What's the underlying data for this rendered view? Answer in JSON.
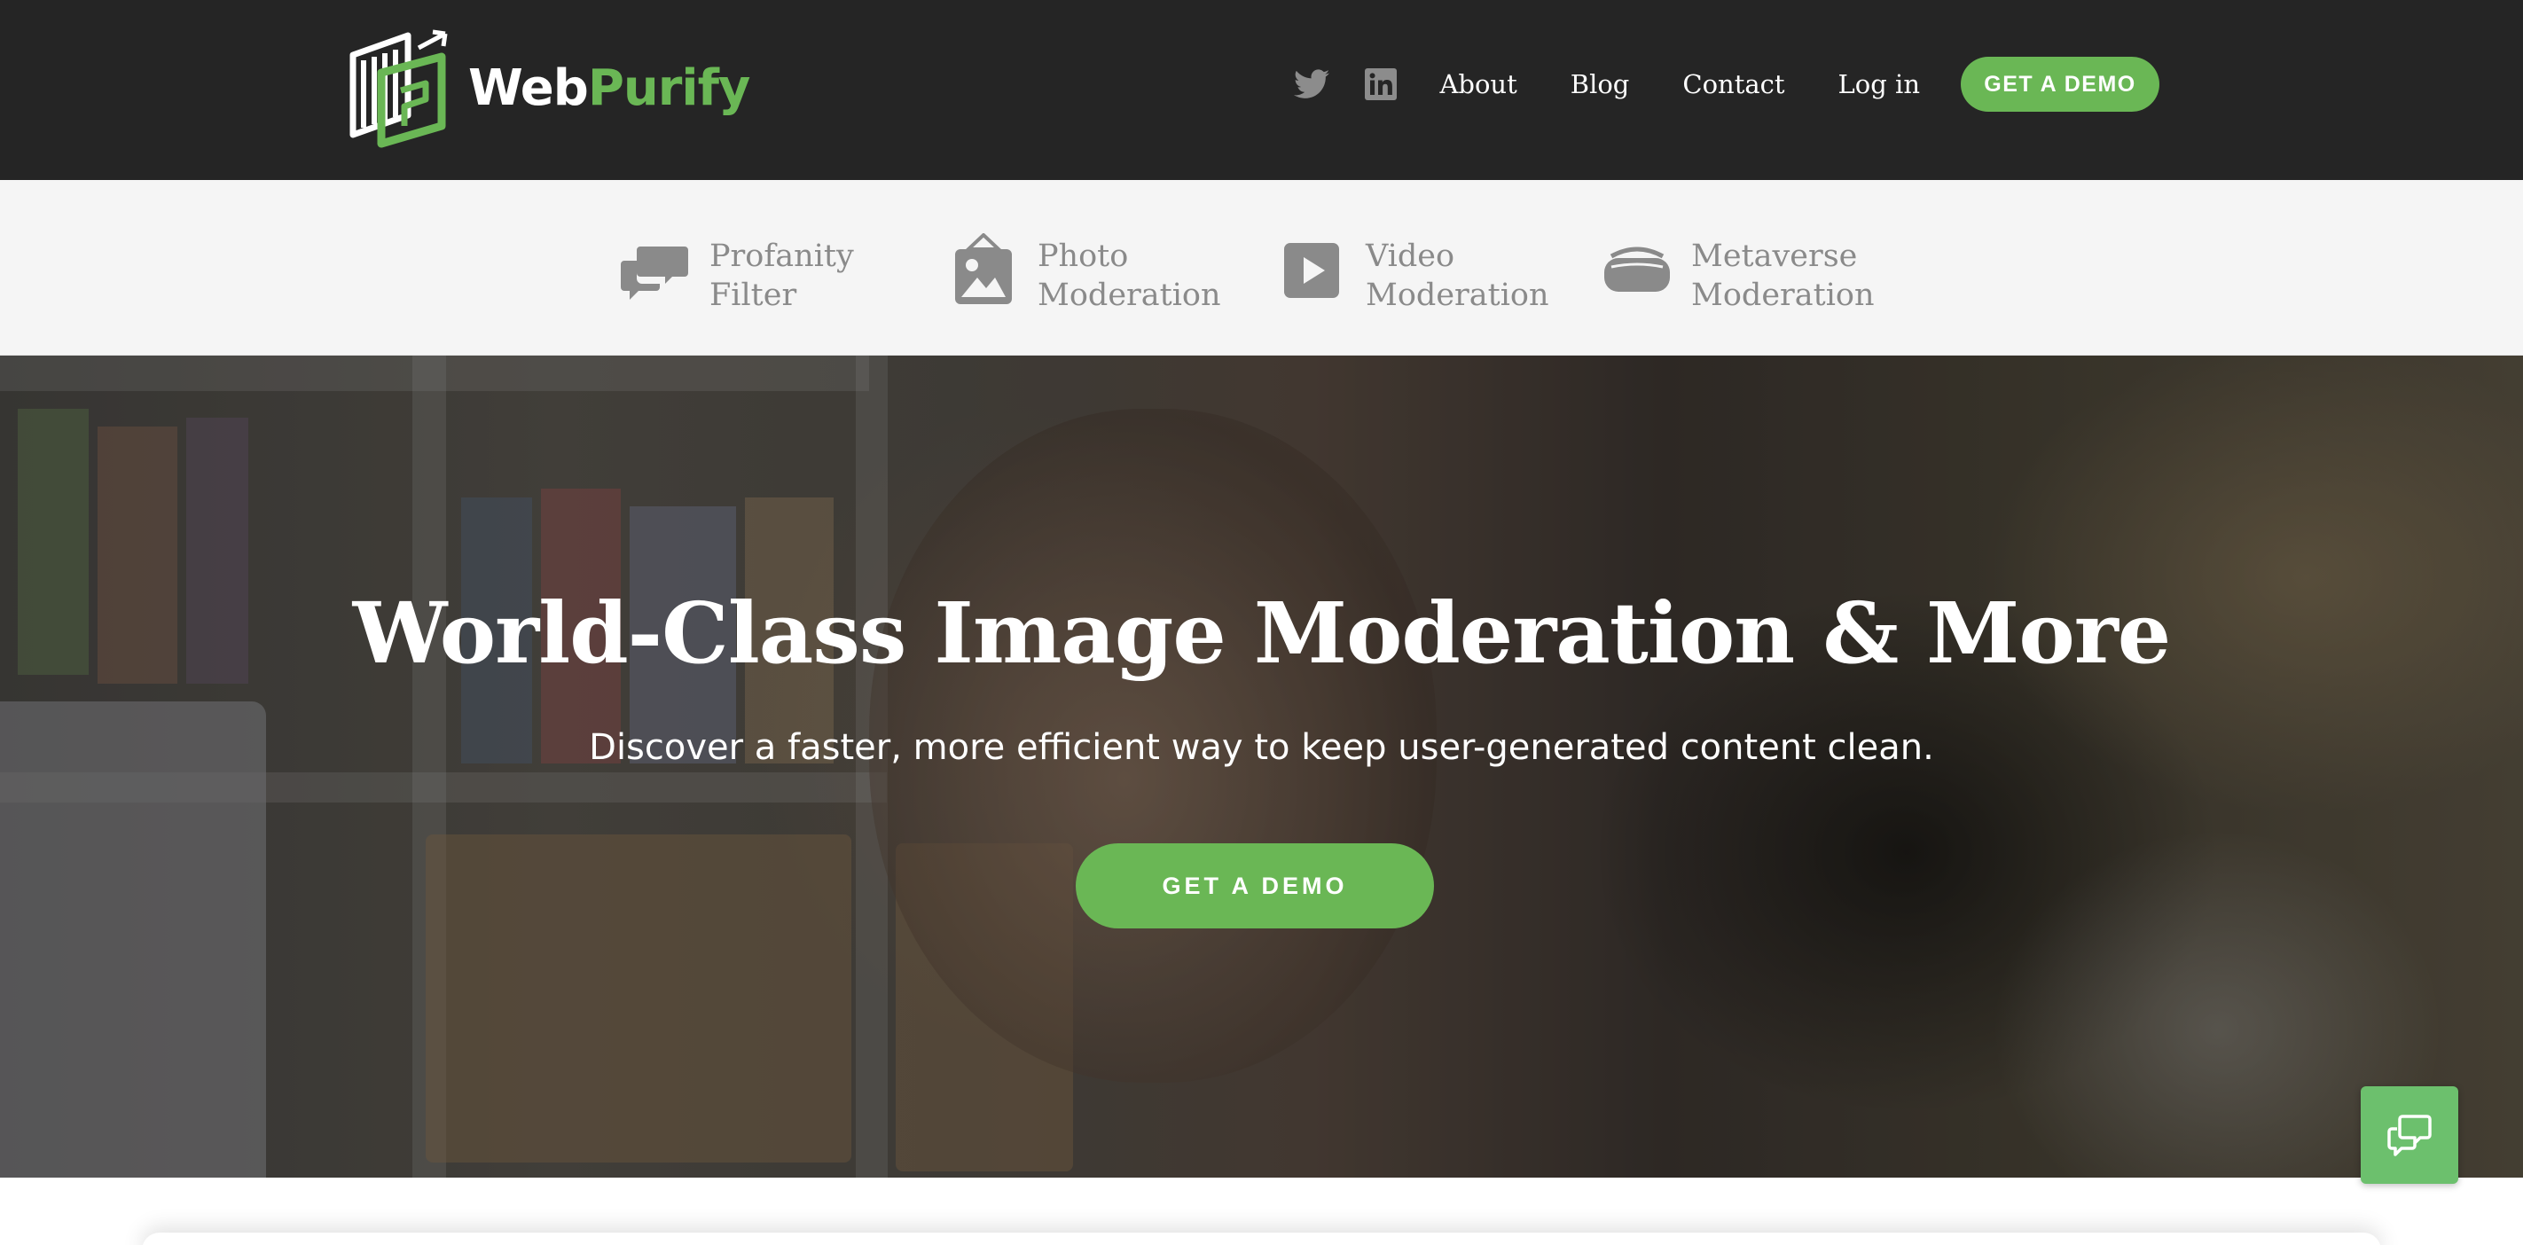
{
  "header": {
    "logo": {
      "text_web": "Web",
      "text_purify": "Purify"
    },
    "social": [
      {
        "name": "twitter",
        "icon": "twitter-icon"
      },
      {
        "name": "linkedin",
        "icon": "linkedin-icon"
      }
    ],
    "nav": {
      "about": "About",
      "blog": "Blog",
      "contact": "Contact",
      "login": "Log in"
    },
    "demo_button": "GET A DEMO"
  },
  "products": [
    {
      "label": "Profanity\nFilter",
      "icon": "speech-bubbles-icon"
    },
    {
      "label": "Photo\nModeration",
      "icon": "framed-picture-icon"
    },
    {
      "label": "Video\nModeration",
      "icon": "play-icon"
    },
    {
      "label": "Metaverse\nModeration",
      "icon": "vr-headset-icon"
    }
  ],
  "hero": {
    "title": "World-Class Image Moderation & More",
    "subtitle": "Discover a faster, more efficient way to keep user-generated content clean.",
    "cta": "GET A DEMO"
  },
  "chat": {
    "icon": "chat-bubbles-icon"
  },
  "colors": {
    "header_bg": "#252525",
    "accent_green": "#6ab755",
    "product_bar_bg": "#f5f5f5",
    "product_text": "#8a8a8a"
  }
}
